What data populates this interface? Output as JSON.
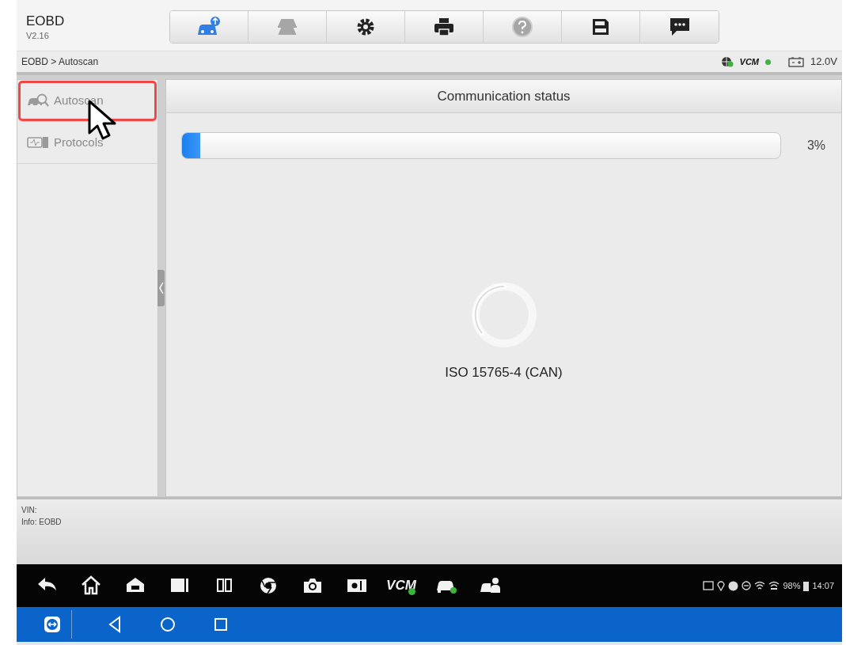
{
  "app": {
    "title": "EOBD",
    "version": "V2.16"
  },
  "toolbar": [
    {
      "kind": "upload",
      "disabled": false
    },
    {
      "kind": "lift",
      "disabled": true
    },
    {
      "kind": "settings",
      "disabled": false
    },
    {
      "kind": "print",
      "disabled": false
    },
    {
      "kind": "help",
      "disabled": true
    },
    {
      "kind": "save",
      "disabled": false
    },
    {
      "kind": "message",
      "disabled": false
    }
  ],
  "breadcrumb": "EOBD > Autoscan",
  "status_indicators": {
    "vcm": "VCM",
    "voltage": "12.0V"
  },
  "sidebar": {
    "items": [
      {
        "label": "Autoscan",
        "kind": "autoscan",
        "highlighted": true
      },
      {
        "label": "Protocols",
        "kind": "protocols",
        "highlighted": false
      }
    ]
  },
  "panel": {
    "title": "Communication status",
    "progress": {
      "level": 0.03,
      "reading": "3%"
    },
    "protocol": "ISO 15765-4 (CAN)"
  },
  "info": [
    "VIN:",
    "Info: EOBD"
  ],
  "taskbar": {
    "apps": [
      {
        "kind": "back"
      },
      {
        "kind": "home"
      },
      {
        "kind": "android-home"
      },
      {
        "kind": "panel"
      },
      {
        "kind": "split"
      },
      {
        "kind": "browser"
      },
      {
        "kind": "camera"
      },
      {
        "kind": "brightness"
      },
      {
        "kind": "vcm",
        "label": "VCM"
      },
      {
        "kind": "car"
      },
      {
        "kind": "remote"
      }
    ],
    "battery": "98%",
    "time": "14:07"
  },
  "navbar": [
    {
      "kind": "remote-app"
    },
    {
      "kind": "back"
    },
    {
      "kind": "home"
    },
    {
      "kind": "recents"
    }
  ]
}
